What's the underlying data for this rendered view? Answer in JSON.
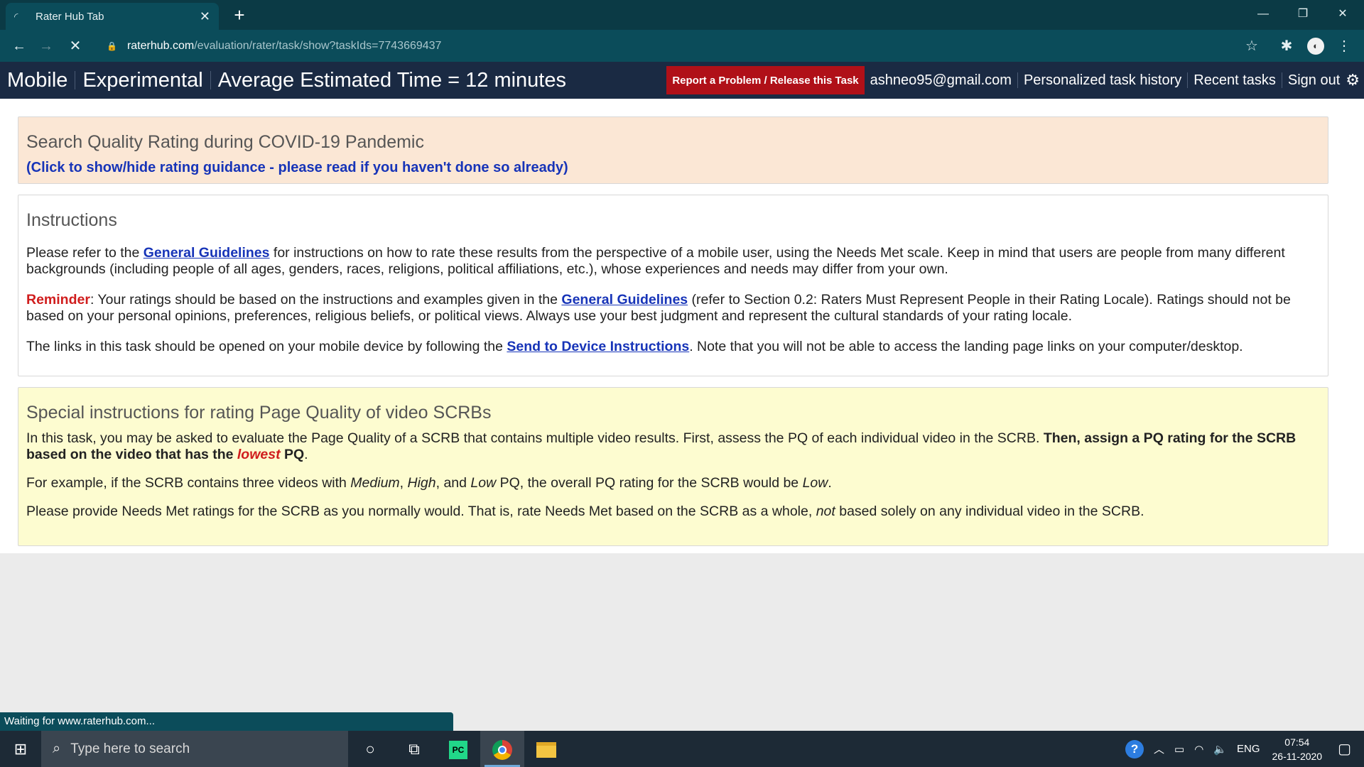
{
  "browser": {
    "tab_title": "Rater Hub Tab",
    "new_tab_label": "+",
    "close_tab_label": "✕",
    "url_host": "raterhub.com",
    "url_path": "/evaluation/rater/task/show?taskIds=7743669437",
    "status_text": "Waiting for www.raterhub.com..."
  },
  "header": {
    "left_items": [
      "Mobile",
      "Experimental",
      "Average Estimated Time = 12 minutes"
    ],
    "report_button": "Report a Problem / Release this Task",
    "email": "ashneo95@gmail.com",
    "history_link": "Personalized task history",
    "recent_link": "Recent tasks",
    "signout_link": "Sign out"
  },
  "guidance": {
    "title": "Search Quality Rating during COVID-19 Pandemic",
    "toggle": "(Click to show/hide rating guidance - please read if you haven't done so already)"
  },
  "instructions": {
    "title": "Instructions",
    "p1_before": "Please refer to the ",
    "p1_link": "General Guidelines",
    "p1_after": " for instructions on how to rate these results from the perspective of a mobile user, using the Needs Met scale. Keep in mind that users are people from many different backgrounds (including people of all ages, genders, races, religions, political affiliations, etc.), whose experiences and needs may differ from your own.",
    "p2_reminder": "Reminder",
    "p2_before": ": Your ratings should be based on the instructions and examples given in the ",
    "p2_link": "General Guidelines",
    "p2_after": " (refer to Section 0.2: Raters Must Represent People in their Rating Locale). Ratings should not be based on your personal opinions, preferences, religious beliefs, or political views. Always use your best judgment and represent the cultural standards of your rating locale.",
    "p3_before": "The links in this task should be opened on your mobile device by following the ",
    "p3_link": "Send to Device Instructions",
    "p3_after": ". Note that you will not be able to access the landing page links on your computer/desktop."
  },
  "special": {
    "title": "Special instructions for rating Page Quality of video SCRBs",
    "p1_plain": "In this task, you may be asked to evaluate the Page Quality of a SCRB that contains multiple video results. First, assess the PQ of each individual video in the SCRB. ",
    "p1_bold": "Then, assign a PQ rating for the SCRB based on the video that has the ",
    "p1_lowest": "lowest",
    "p1_bold_end": " PQ",
    "p1_end": ".",
    "p2_a": "For example, if the SCRB contains three videos with ",
    "p2_medium": "Medium",
    "p2_b": ", ",
    "p2_high": "High",
    "p2_c": ", and ",
    "p2_low": "Low",
    "p2_d": " PQ, the overall PQ rating for the SCRB would be ",
    "p2_low2": "Low",
    "p2_e": ".",
    "p3_a": "Please provide Needs Met ratings for the SCRB as you normally would. That is, rate Needs Met based on the SCRB as a whole, ",
    "p3_not": "not",
    "p3_b": " based solely on any individual video in the SCRB."
  },
  "taskbar": {
    "search_placeholder": "Type here to search",
    "pycharm_label": "PC",
    "language": "ENG",
    "time": "07:54",
    "date": "26-11-2020"
  }
}
